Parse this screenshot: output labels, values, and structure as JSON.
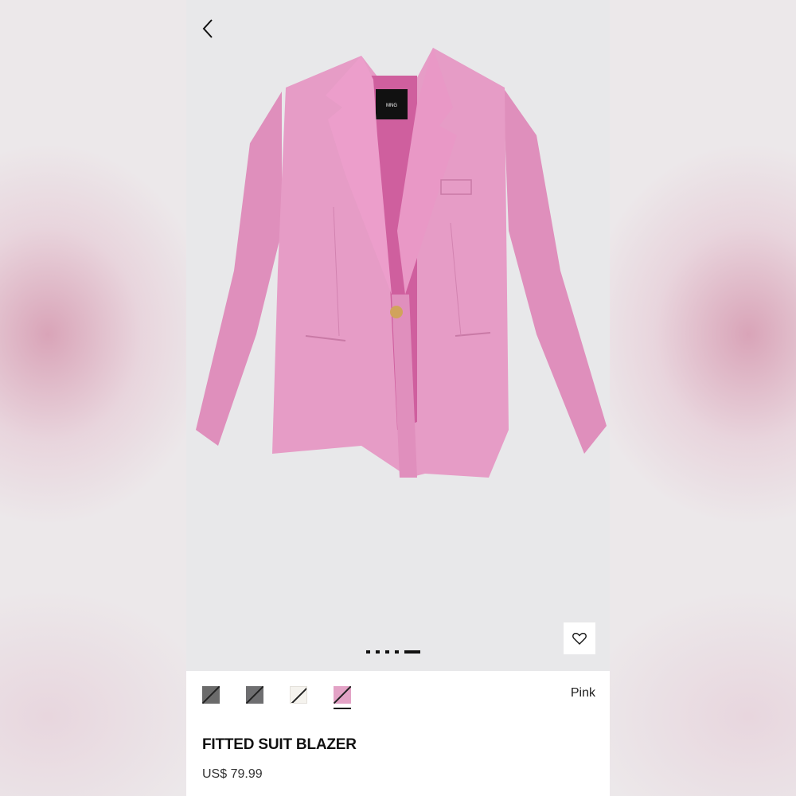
{
  "product": {
    "name": "FITTED SUIT BLAZER",
    "price": "US$ 79.99",
    "selected_color": "Pink",
    "brand_tag": "MNG"
  },
  "gallery": {
    "image_count": 5,
    "active_index": 4
  },
  "swatches": [
    {
      "color": "#6b6b6b",
      "selected": false
    },
    {
      "color": "#6e6e70",
      "selected": false
    },
    {
      "color": "#f5f3ee",
      "selected": false
    },
    {
      "color": "#e3a3c6",
      "selected": true
    }
  ],
  "icons": {
    "back": "chevron-left-icon",
    "favorite": "heart-icon"
  },
  "colors": {
    "gallery_bg": "#e8e8ea",
    "blazer": "#e497c3",
    "text": "#111111"
  }
}
